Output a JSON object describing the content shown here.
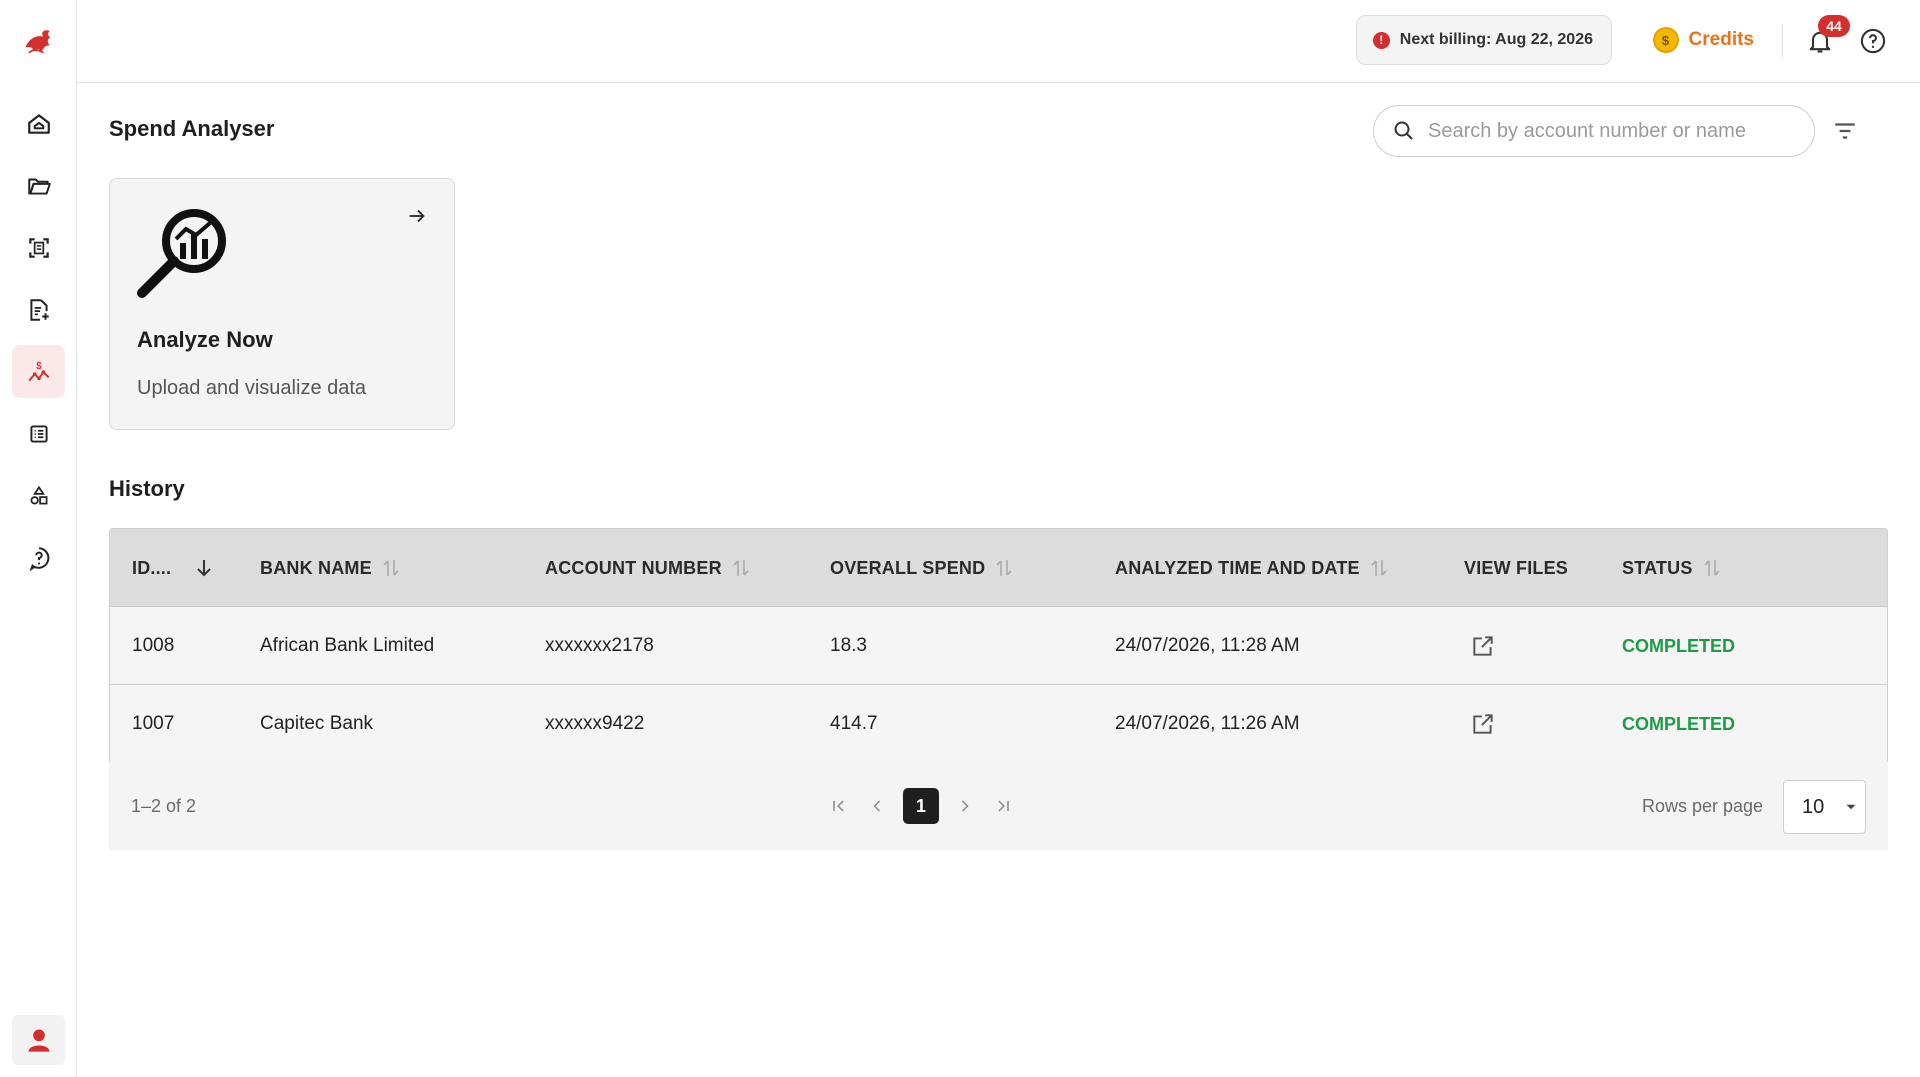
{
  "topbar": {
    "billing_text": "Next billing: Aug 22, 2026",
    "credits_label": "Credits",
    "coin_symbol": "$",
    "notification_count": "44"
  },
  "sidebar": {
    "items": [
      {
        "name": "home",
        "icon": "home-icon"
      },
      {
        "name": "folder",
        "icon": "folder-icon"
      },
      {
        "name": "scan",
        "icon": "scan-icon"
      },
      {
        "name": "document-add",
        "icon": "document-add-icon"
      },
      {
        "name": "spend-analyser",
        "icon": "spend-chart-icon",
        "active": true
      },
      {
        "name": "list",
        "icon": "list-icon"
      },
      {
        "name": "shapes",
        "icon": "shapes-icon"
      },
      {
        "name": "help",
        "icon": "help-icon"
      }
    ]
  },
  "page": {
    "title": "Spend Analyser",
    "search_placeholder": "Search by account number or name"
  },
  "card": {
    "title": "Analyze Now",
    "subtitle": "Upload and visualize data"
  },
  "history": {
    "title": "History",
    "columns": [
      "ID....",
      "BANK NAME",
      "ACCOUNT NUMBER",
      "OVERALL SPEND",
      "ANALYZED TIME AND DATE",
      "VIEW FILES",
      "STATUS"
    ],
    "rows": [
      {
        "id": "1008",
        "bank": "African Bank Limited",
        "account": "xxxxxxx2178",
        "spend": "18.3",
        "datetime": "24/07/2026, 11:28 AM",
        "status": "COMPLETED"
      },
      {
        "id": "1007",
        "bank": "Capitec Bank",
        "account": "xxxxxx9422",
        "spend": "414.7",
        "datetime": "24/07/2026, 11:26 AM",
        "status": "COMPLETED"
      }
    ]
  },
  "pagination": {
    "range": "1–2 of 2",
    "current_page": "1",
    "rows_per_page_label": "Rows per page",
    "rows_per_page_value": "10"
  },
  "colors": {
    "brand": "#d32f2f",
    "credits": "#e8731a",
    "status_completed": "#1e9b47"
  }
}
